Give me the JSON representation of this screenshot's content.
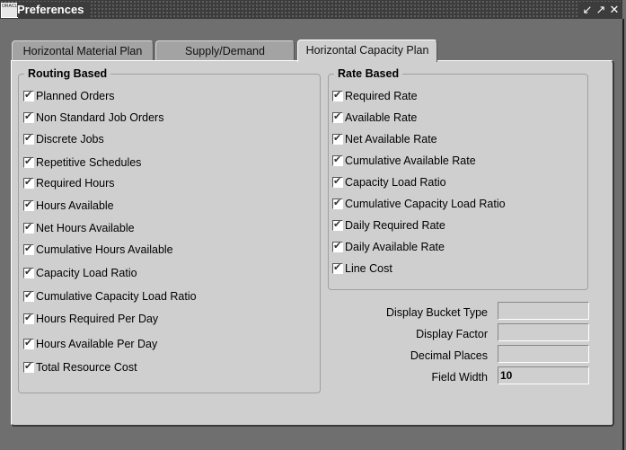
{
  "window": {
    "title": "Preferences",
    "app_icon_text": "ORACLE",
    "controls": [
      {
        "name": "minimize",
        "glyph": "↙"
      },
      {
        "name": "maximize",
        "glyph": "↗"
      },
      {
        "name": "close",
        "glyph": "✕"
      }
    ]
  },
  "tabs": [
    {
      "label": "Horizontal Material Plan",
      "active": false
    },
    {
      "label": "Supply/Demand",
      "active": false
    },
    {
      "label": "Horizontal Capacity Plan",
      "active": true
    }
  ],
  "routing_based": {
    "title": "Routing Based",
    "items": [
      {
        "label": "Planned Orders",
        "checked": true
      },
      {
        "label": "Non Standard Job Orders",
        "checked": true
      },
      {
        "label": "Discrete Jobs",
        "checked": true
      },
      {
        "label": "Repetitive Schedules",
        "checked": true
      },
      {
        "label": "Required Hours",
        "checked": true
      },
      {
        "label": "Hours Available",
        "checked": true
      },
      {
        "label": "Net Hours Available",
        "checked": true
      },
      {
        "label": "Cumulative Hours Available",
        "checked": true
      },
      {
        "label": "Capacity Load Ratio",
        "checked": true
      },
      {
        "label": "Cumulative Capacity Load Ratio",
        "checked": true
      },
      {
        "label": "Hours Required Per Day",
        "checked": true
      },
      {
        "label": "Hours Available Per Day",
        "checked": true
      },
      {
        "label": "Total Resource Cost",
        "checked": true
      }
    ]
  },
  "rate_based": {
    "title": "Rate Based",
    "items": [
      {
        "label": "Required Rate",
        "checked": true
      },
      {
        "label": "Available Rate",
        "checked": true
      },
      {
        "label": "Net Available Rate",
        "checked": true
      },
      {
        "label": "Cumulative Available Rate",
        "checked": true
      },
      {
        "label": "Capacity Load Ratio",
        "checked": true
      },
      {
        "label": "Cumulative Capacity Load Ratio",
        "checked": true
      },
      {
        "label": "Daily Required Rate",
        "checked": true
      },
      {
        "label": "Daily Available Rate",
        "checked": true
      },
      {
        "label": "Line Cost",
        "checked": true
      }
    ]
  },
  "fields": [
    {
      "label": "Display Bucket Type",
      "value": ""
    },
    {
      "label": "Display Factor",
      "value": ""
    },
    {
      "label": "Decimal Places",
      "value": ""
    },
    {
      "label": "Field Width",
      "value": "10"
    }
  ]
}
